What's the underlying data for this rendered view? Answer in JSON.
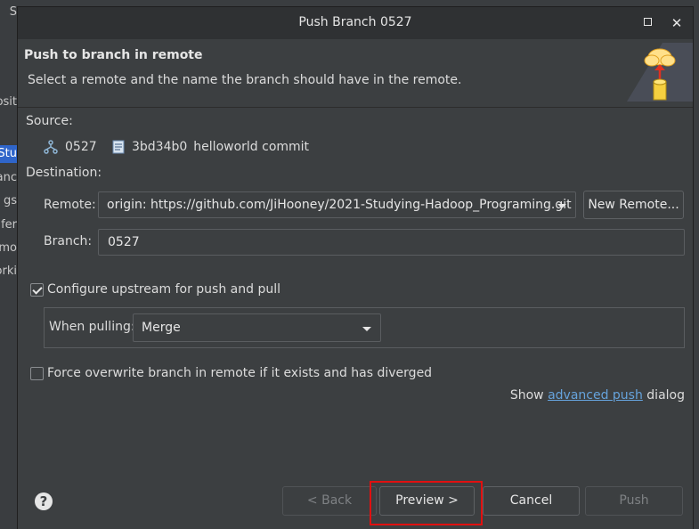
{
  "background": {
    "fragments": [
      "S",
      "osit",
      "-Stu",
      "anc",
      "gs",
      "fer",
      "mo",
      "orki"
    ]
  },
  "dialog": {
    "title": "Push Branch 0527",
    "banner_title": "Push to branch in remote",
    "banner_description": "Select a remote and the name the branch should have in the remote."
  },
  "source": {
    "label": "Source:",
    "branch": "0527",
    "commit_id": "3bd34b0",
    "commit_message": "helloworld commit"
  },
  "destination": {
    "label": "Destination:",
    "remote_label": "Remote:",
    "remote_value": "origin: https://github.com/JiHooney/2021-Studying-Hadoop_Programing.git",
    "new_remote_label": "New Remote...",
    "branch_label": "Branch:",
    "branch_value": "0527"
  },
  "upstream": {
    "checkbox_label": "Configure upstream for push and pull",
    "checked": true,
    "when_pulling_label": "When pulling:",
    "when_pulling_value": "Merge"
  },
  "force": {
    "checkbox_label": "Force overwrite branch in remote if it exists and has diverged",
    "checked": false
  },
  "advanced": {
    "prefix": "Show ",
    "link": "advanced push",
    "suffix": " dialog"
  },
  "buttons": {
    "back": "< Back",
    "preview": "Preview >",
    "cancel": "Cancel",
    "push": "Push"
  },
  "colors": {
    "highlight": "#e01010",
    "link": "#66a3dc"
  }
}
